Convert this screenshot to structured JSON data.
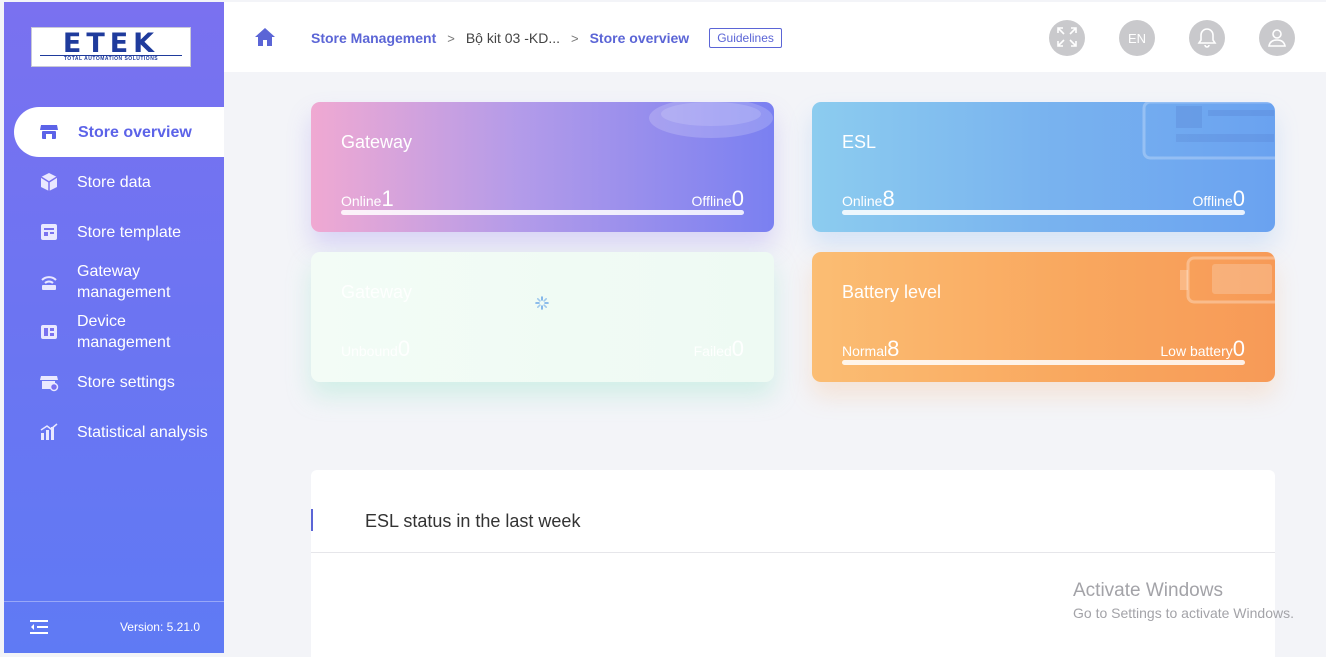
{
  "brand": {
    "logo_text": "ETEK",
    "logo_tagline": "TOTAL AUTOMATION SOLUTIONS"
  },
  "sidebar": {
    "items": [
      {
        "label": "Store overview",
        "icon": "store-icon",
        "active": true
      },
      {
        "label": "Store data",
        "icon": "cube-icon",
        "active": false
      },
      {
        "label": "Store template",
        "icon": "template-icon",
        "active": false
      },
      {
        "label": "Gateway management",
        "icon": "gateway-icon",
        "active": false
      },
      {
        "label": "Device management",
        "icon": "device-icon",
        "active": false
      },
      {
        "label": "Store settings",
        "icon": "store-settings-icon",
        "active": false
      },
      {
        "label": "Statistical analysis",
        "icon": "bar-chart-icon",
        "active": false
      }
    ],
    "version": "Version: 5.21.0"
  },
  "breadcrumb": {
    "items": [
      "Store Management",
      "Bộ kit 03 -KD...",
      "Store overview"
    ],
    "guidelines": "Guidelines"
  },
  "topbar": {
    "language": "EN"
  },
  "cards": {
    "gateway": {
      "title": "Gateway",
      "left_label": "Online",
      "left_value": "1",
      "right_label": "Offline",
      "right_value": "0"
    },
    "esl": {
      "title": "ESL",
      "left_label": "Online",
      "left_value": "8",
      "right_label": "Offline",
      "right_value": "0"
    },
    "third": {
      "title": "Gateway",
      "left_label": "Unbound",
      "left_value": "0",
      "right_label": "Failed",
      "right_value": "0"
    },
    "battery": {
      "title": "Battery level",
      "left_label": "Normal",
      "left_value": "8",
      "right_label": "Low battery",
      "right_value": "0"
    }
  },
  "panel": {
    "title": "ESL status in the last week"
  },
  "watermark": {
    "line1": "Activate Windows",
    "line2": "Go to Settings to activate Windows."
  },
  "colors": {
    "accent": "#5b65d6",
    "sidebar_top": "#7a71f0",
    "sidebar_bottom": "#5f7af4"
  }
}
